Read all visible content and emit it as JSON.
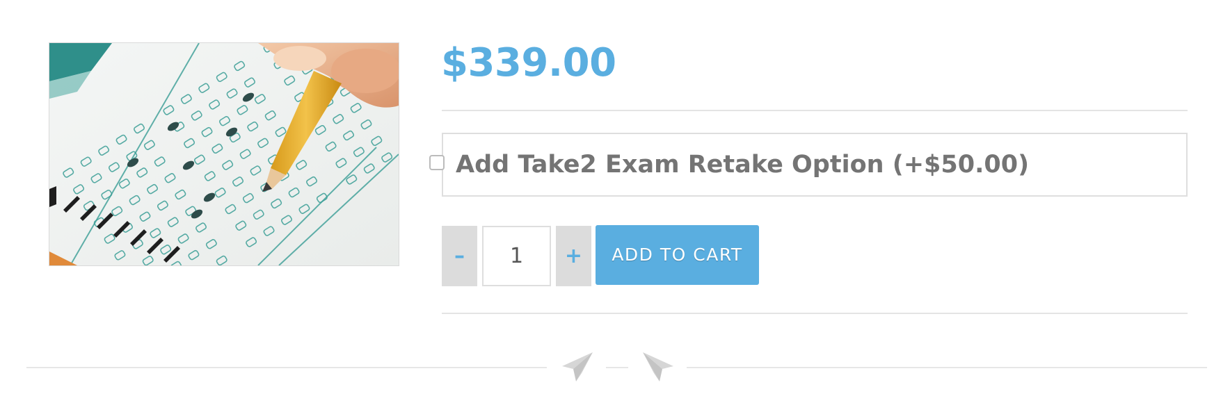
{
  "product": {
    "image_description_name": "exam-answer-sheet-image",
    "price": "$339.00",
    "addon": {
      "label": "Add Take2 Exam Retake Option (+$50.00)",
      "checked": false
    },
    "quantity": {
      "minus_label": "–",
      "value": "1",
      "plus_label": "+"
    },
    "add_to_cart_label": "ADD TO CART"
  },
  "colors": {
    "accent": "#5aaee0",
    "addon_text": "#747474",
    "qty_bg": "#dcdcdc",
    "divider": "#e4e4e4"
  },
  "icons": {
    "separator_left": "paper-plane-icon",
    "separator_right": "paper-plane-icon"
  }
}
